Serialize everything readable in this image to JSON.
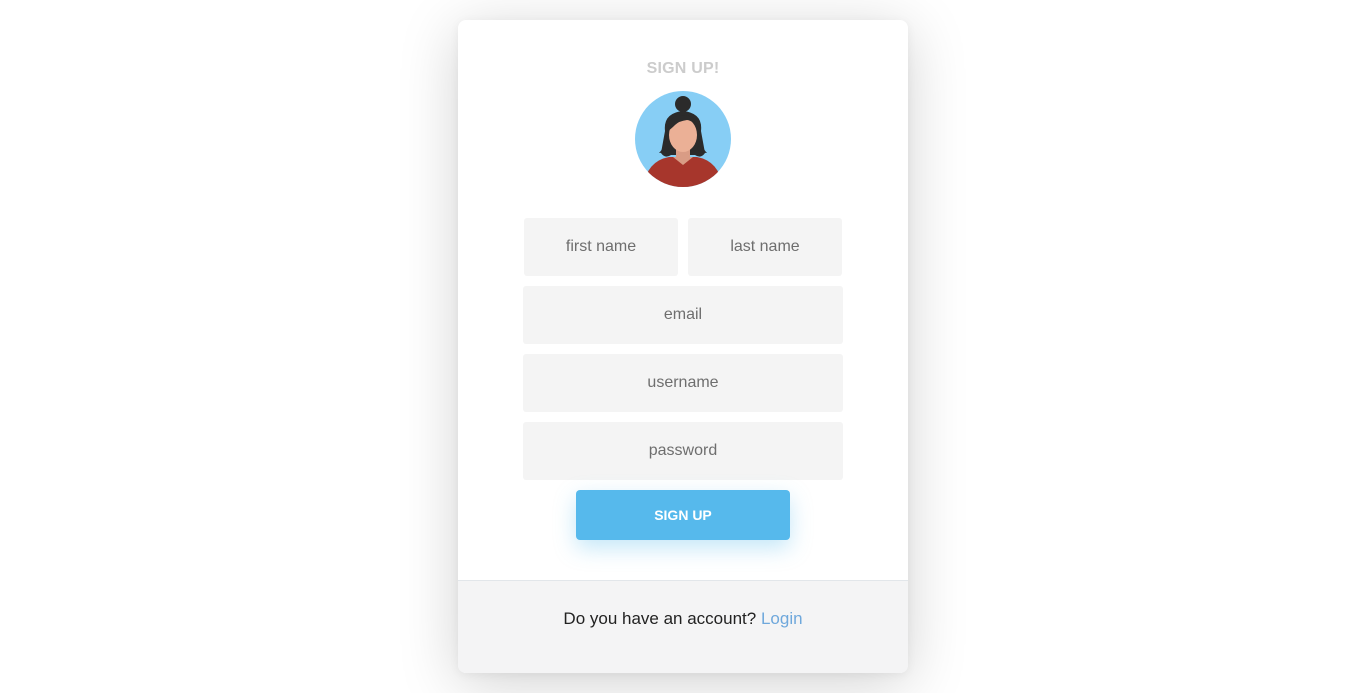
{
  "form": {
    "title": "SIGN UP!",
    "first_name_placeholder": "first name",
    "last_name_placeholder": "last name",
    "email_placeholder": "email",
    "username_placeholder": "username",
    "password_placeholder": "password",
    "submit_label": "SIGN UP"
  },
  "footer": {
    "prompt": "Do you have an account?",
    "login_label": "Login"
  },
  "colors": {
    "accent": "#56b9ec",
    "link": "#6fa8dc",
    "avatar_bg": "#87cef5",
    "avatar_shirt": "#a7362c"
  },
  "avatar": {
    "icon": "woman-avatar-icon"
  }
}
